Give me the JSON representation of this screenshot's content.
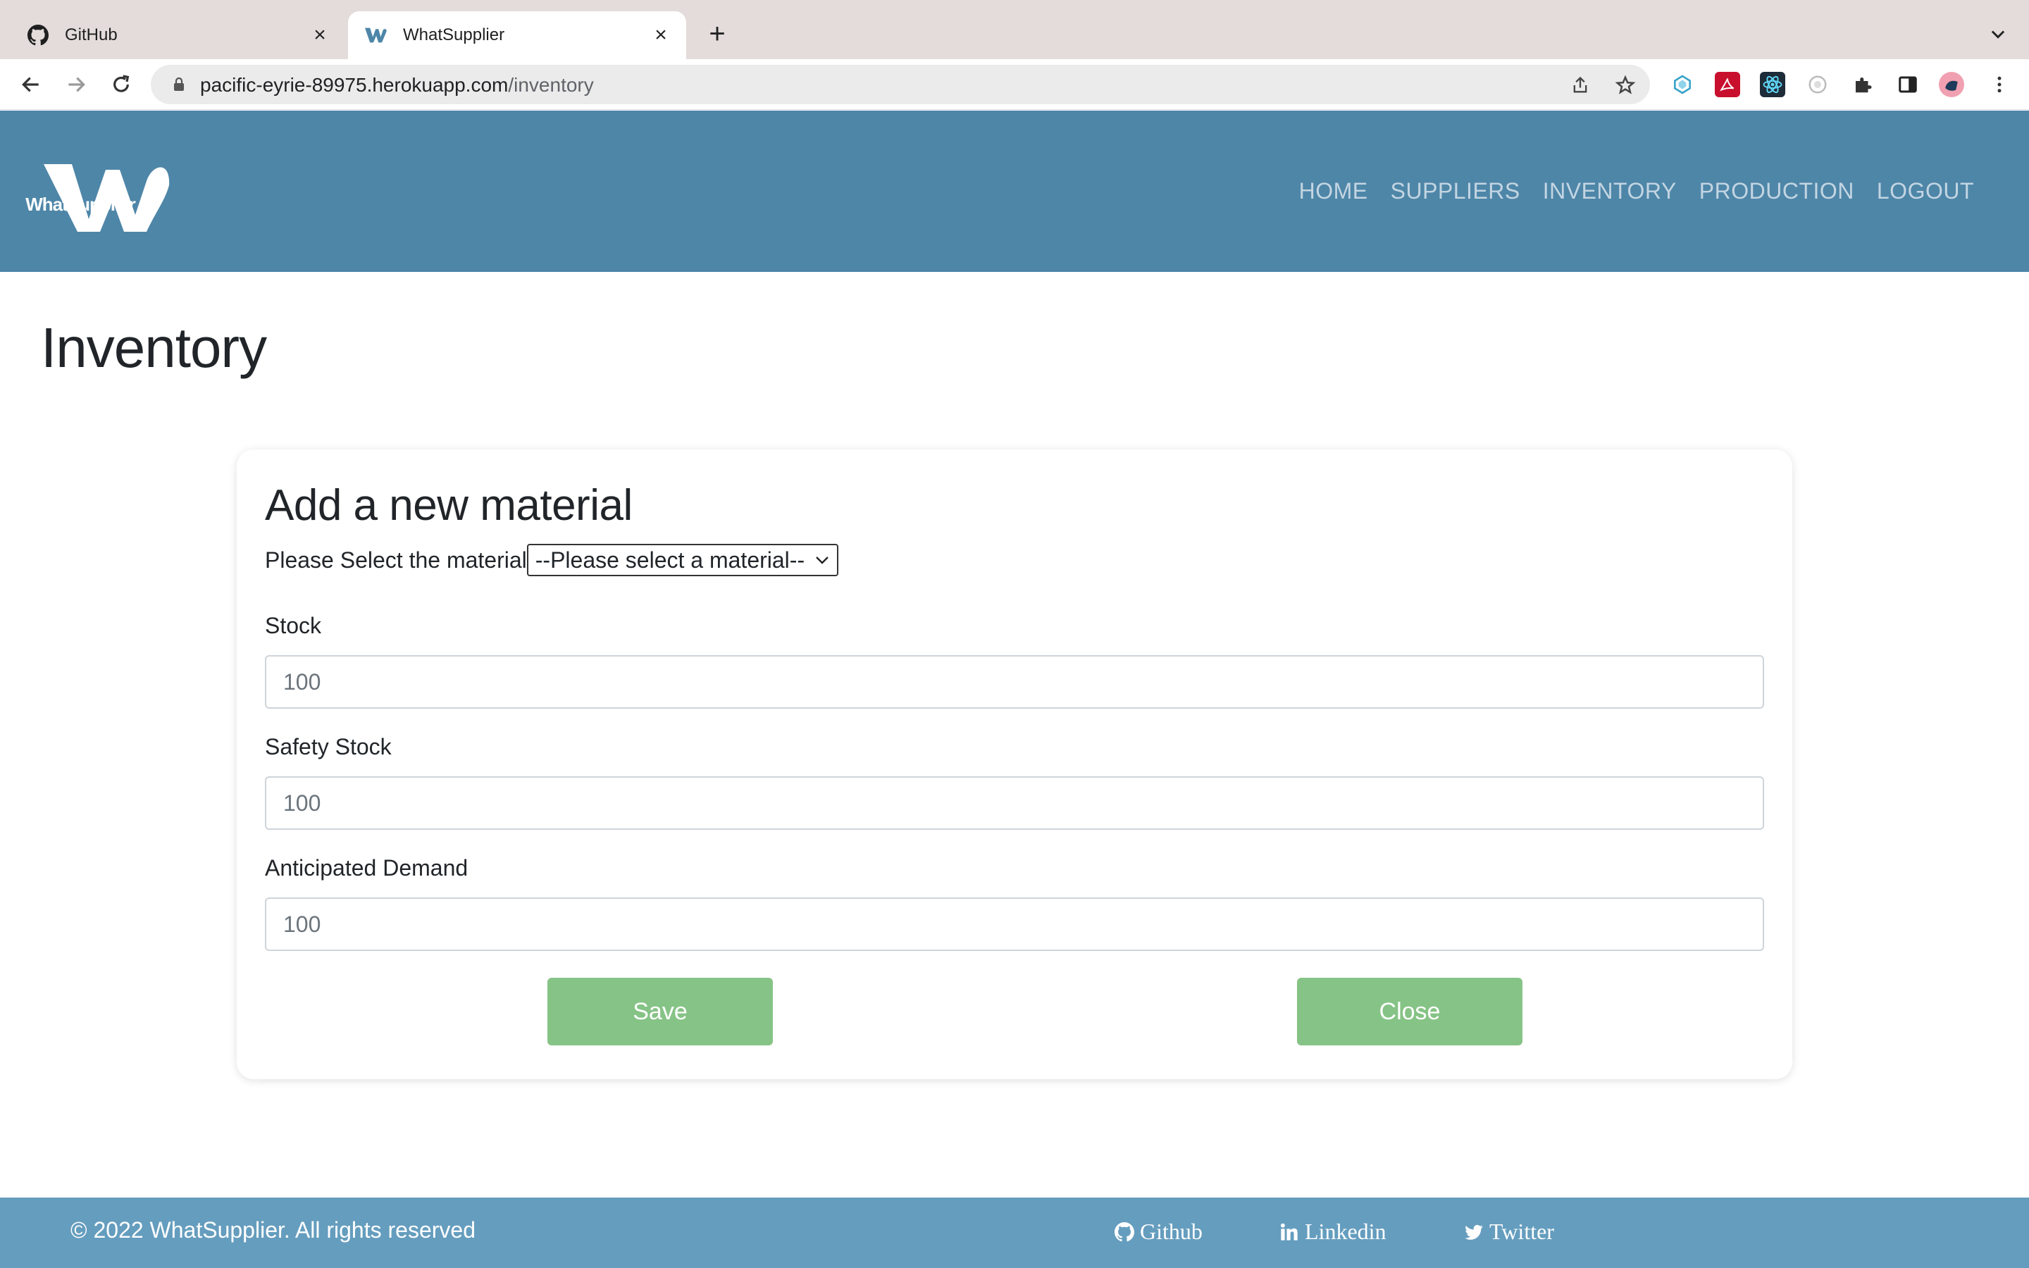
{
  "browser": {
    "tabs": [
      {
        "title": "GitHub",
        "icon": "github-icon",
        "active": false
      },
      {
        "title": "WhatSupplier",
        "icon": "whatsupplier-favicon",
        "active": true
      }
    ],
    "new_tab_label": "+",
    "url_domain": "pacific-eyrie-89975.herokuapp.com",
    "url_path": "/inventory"
  },
  "header": {
    "logo_text": "WhatSupplier",
    "nav": [
      "HOME",
      "SUPPLIERS",
      "INVENTORY",
      "PRODUCTION",
      "LOGOUT"
    ]
  },
  "page": {
    "title": "Inventory"
  },
  "form": {
    "title": "Add a new material",
    "select_label": "Please Select the material",
    "select_value": "--Please select a material--",
    "fields": [
      {
        "label": "Stock",
        "placeholder": "100"
      },
      {
        "label": "Safety Stock",
        "placeholder": "100"
      },
      {
        "label": "Anticipated Demand",
        "placeholder": "100"
      }
    ],
    "save_label": "Save",
    "close_label": "Close"
  },
  "footer": {
    "copyright": "© 2022 WhatSupplier. All rights reserved",
    "links": [
      "Github",
      "Linkedin",
      "Twitter"
    ]
  },
  "colors": {
    "header_bg": "#4e86a8",
    "footer_bg": "#659dbe",
    "button_bg": "#86c386",
    "nav_text": "#c3d5e2"
  }
}
